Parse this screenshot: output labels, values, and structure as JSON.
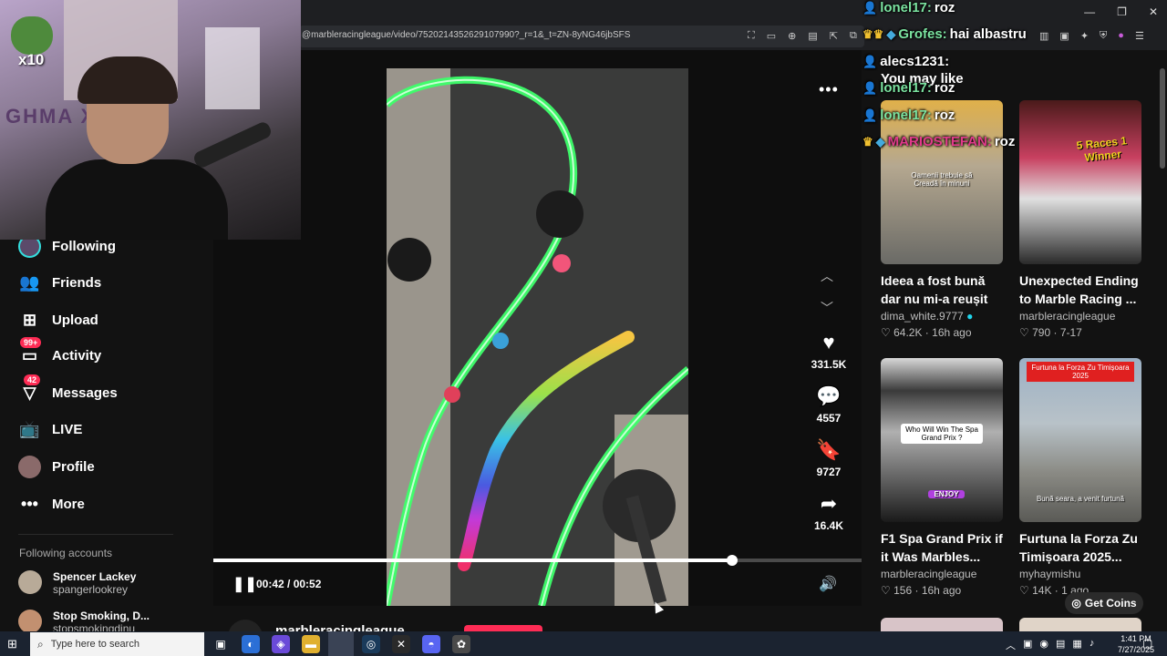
{
  "browser": {
    "url": "@marbleracingleague/video/7520214352629107990?_r=1&_t=ZN-8yNG46jbSFS",
    "window_controls": [
      "—",
      "❐",
      "✕"
    ]
  },
  "webcam": {
    "overlay_text": "x10",
    "wall_text": "GHMA X K"
  },
  "sidebar": {
    "items": [
      {
        "label": "Following",
        "icon": "following-icon",
        "badge": ""
      },
      {
        "label": "Friends",
        "icon": "friends-icon",
        "badge": ""
      },
      {
        "label": "Upload",
        "icon": "upload-icon",
        "badge": ""
      },
      {
        "label": "Activity",
        "icon": "activity-icon",
        "badge": "99+"
      },
      {
        "label": "Messages",
        "icon": "messages-icon",
        "badge": "42"
      },
      {
        "label": "LIVE",
        "icon": "live-icon",
        "badge": ""
      },
      {
        "label": "Profile",
        "icon": "profile-avatar",
        "badge": ""
      },
      {
        "label": "More",
        "icon": "more-icon",
        "badge": ""
      }
    ],
    "following_heading": "Following accounts",
    "accounts": [
      {
        "name": "Spencer Lackey",
        "handle": "spangerlookrey"
      },
      {
        "name": "Stop Smoking, D...",
        "handle": "stopsmokingdinu"
      }
    ]
  },
  "player": {
    "time": "00:42 / 00:52",
    "progress": 0.8,
    "likes": "331.5K",
    "comments": "4557",
    "saves": "9727",
    "shares": "16.4K",
    "author": "marbleracingleague"
  },
  "recommendations": {
    "heading": "You may like",
    "cards": [
      {
        "title": "Ideea a fost bună dar nu mi-a reușit 🥲 d...",
        "author": "dima_white.9777",
        "verified": true,
        "likes": "64.2K",
        "age": "16h ago",
        "caption": "Oamenii trebuie să Creadă în minuni",
        "badge": "",
        "race_text": ""
      },
      {
        "title": "Unexpected Ending to Marble Racing ...",
        "author": "marbleracingleague",
        "verified": false,
        "likes": "790",
        "age": "7-17",
        "caption": "",
        "badge": "",
        "race_text": "5 Races 1 Winner"
      },
      {
        "title": "F1 Spa Grand Prix if it Was Marbles...",
        "author": "marbleracingleague",
        "verified": false,
        "likes": "156",
        "age": "16h ago",
        "caption": "Who Will Win The Spa Grand Prix ?",
        "badge": "",
        "race_text": "ENJOY"
      },
      {
        "title": "Furtuna la Forza Zu Timișoara 2025...",
        "author": "myhaymishu",
        "verified": false,
        "likes": "14K",
        "age": "1 ago",
        "caption": "Bună seara, a venit furtună",
        "badge": "Furtuna la Forza Zu Timișoara 2025",
        "race_text": ""
      }
    ],
    "get_coins": "Get Coins"
  },
  "chat": [
    {
      "user": "lonel17:",
      "msg": "roz",
      "user_color": "#7be3a0"
    },
    {
      "user": "Grofes:",
      "msg": "hai albastru",
      "user_color": "#7be3a0"
    },
    {
      "user": "alecs1231:",
      "msg": "",
      "user_color": "#ffffff"
    },
    {
      "user": "lonel17:",
      "msg": "roz",
      "user_color": "#7be3a0"
    },
    {
      "user": "lonel17:",
      "msg": "roz",
      "user_color": "#7be3a0"
    },
    {
      "user": "MARIOSTEFAN:",
      "msg": "roz",
      "user_color": "#e03a8a"
    }
  ],
  "taskbar": {
    "search_placeholder": "Type here to search",
    "time": "1:41 PM",
    "date": "7/27/2025"
  },
  "colors": {
    "accent": "#fe2c55",
    "background": "#121212",
    "neon": "#3dff6a"
  }
}
